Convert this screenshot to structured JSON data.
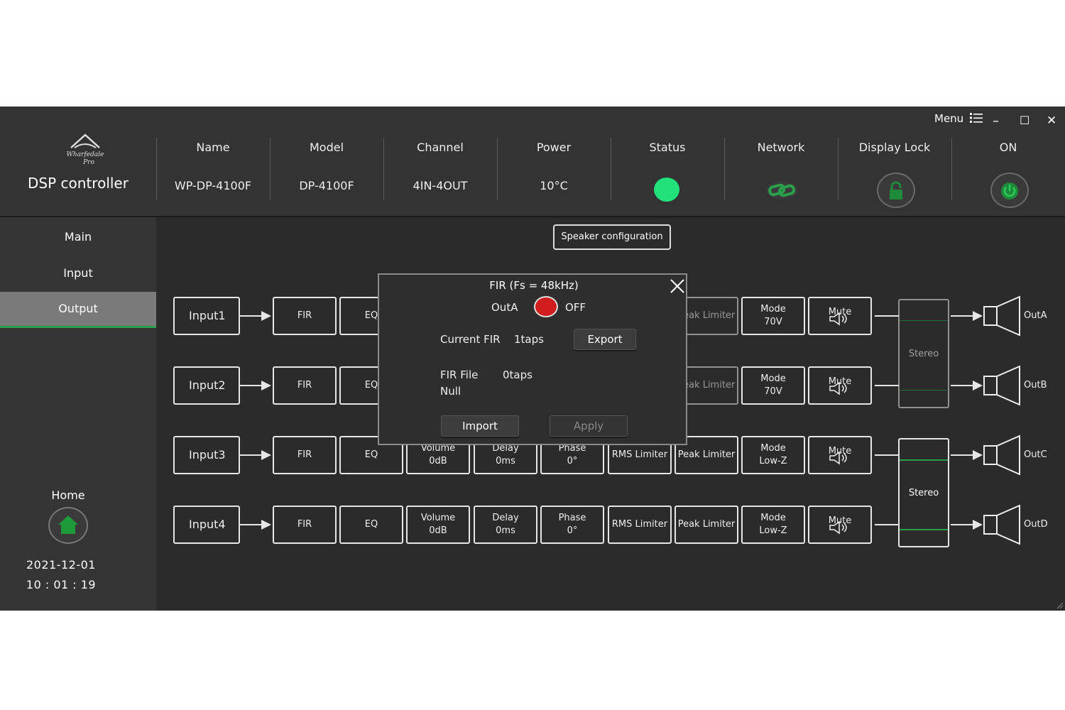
{
  "app": {
    "title": "DSP controller",
    "logo_text": "Wharfedale Pro"
  },
  "window": {
    "menu_label": "Menu",
    "minimize": "–",
    "maximize": "☐",
    "close": "✕"
  },
  "header": {
    "name_label": "Name",
    "name_value": "WP-DP-4100F",
    "model_label": "Model",
    "model_value": "DP-4100F",
    "channel_label": "Channel",
    "channel_value": "4IN-4OUT",
    "power_label": "Power",
    "power_value": "10°C",
    "status_label": "Status",
    "network_label": "Network",
    "lock_label": "Display Lock",
    "on_label": "ON"
  },
  "sidebar": {
    "items": [
      {
        "label": "Main"
      },
      {
        "label": "Input"
      },
      {
        "label": "Output"
      }
    ],
    "home_label": "Home",
    "date": "2021-12-01",
    "time": "10 : 01 : 19"
  },
  "main": {
    "speaker_config": "Speaker configuration",
    "rows": [
      {
        "input": "Input1",
        "fir": "FIR",
        "eq": "EQ",
        "peak": "Peak Limiter",
        "mode": "Mode",
        "mode_val": "70V",
        "mute": "Mute",
        "out": "OutA"
      },
      {
        "input": "Input2",
        "fir": "FIR",
        "eq": "EQ",
        "peak": "Peak Limiter",
        "mode": "Mode",
        "mode_val": "70V",
        "mute": "Mute",
        "out": "OutB"
      },
      {
        "input": "Input3",
        "fir": "FIR",
        "eq": "EQ",
        "vol": "Volume",
        "vol_val": "0dB",
        "delay": "Delay",
        "delay_val": "0ms",
        "phase": "Phase",
        "phase_val": "0°",
        "rms": "RMS Limiter",
        "peak": "Peak Limiter",
        "mode": "Mode",
        "mode_val": "Low-Z",
        "mute": "Mute",
        "out": "OutC"
      },
      {
        "input": "Input4",
        "fir": "FIR",
        "eq": "EQ",
        "vol": "Volume",
        "vol_val": "0dB",
        "delay": "Delay",
        "delay_val": "0ms",
        "phase": "Phase",
        "phase_val": "0°",
        "rms": "RMS Limiter",
        "peak": "Peak Limiter",
        "mode": "Mode",
        "mode_val": "Low-Z",
        "mute": "Mute",
        "out": "OutD"
      }
    ],
    "stereo_top": "Stereo",
    "stereo_bottom": "Stereo"
  },
  "modal": {
    "title": "FIR (Fs = 48kHz)",
    "channel": "OutA",
    "toggle_state": "OFF",
    "current_fir_label": "Current FIR",
    "current_fir_value": "1taps",
    "export": "Export",
    "fir_file_label": "FIR File",
    "fir_file_taps": "0taps",
    "fir_file_name": "Null",
    "import": "Import",
    "apply": "Apply"
  },
  "colors": {
    "background": "#2b2b2b",
    "header": "#333333",
    "status_ok": "#22e07a",
    "accent_green": "#2aa04a",
    "toggle_red": "#d11d1d"
  }
}
